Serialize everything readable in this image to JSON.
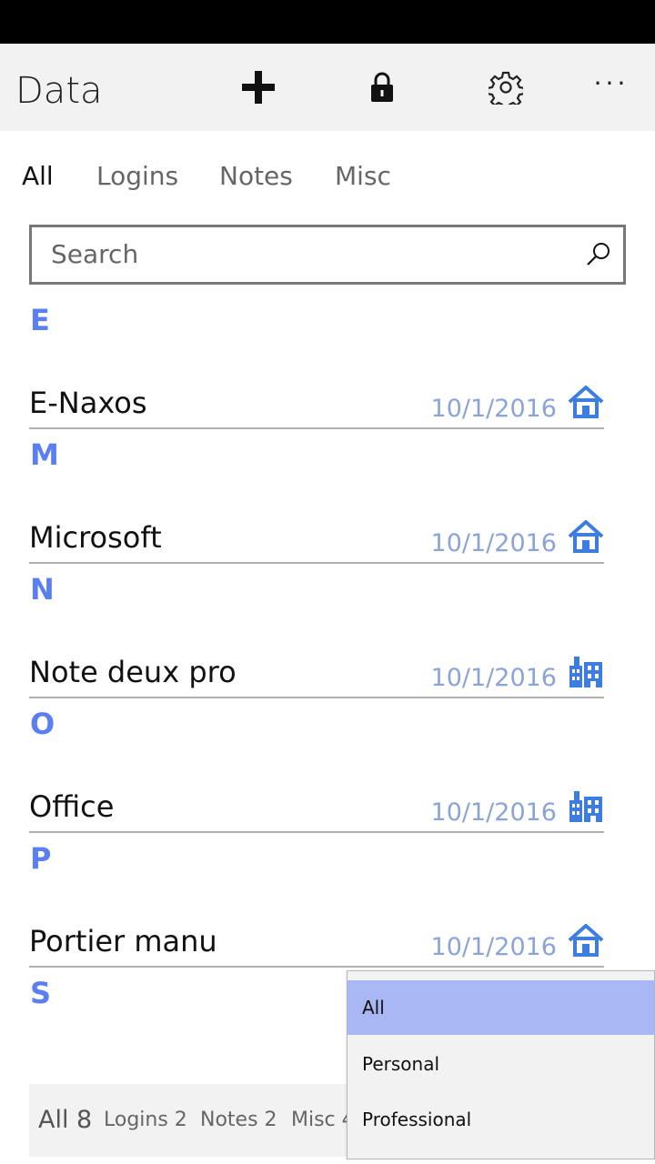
{
  "app_bar": {
    "title": "Data",
    "add_icon": "plus-icon",
    "lock_icon": "lock-icon",
    "settings_icon": "gear-icon",
    "more_label": "···"
  },
  "tabs": [
    {
      "label": "All",
      "active": true
    },
    {
      "label": "Logins",
      "active": false
    },
    {
      "label": "Notes",
      "active": false
    },
    {
      "label": "Misc",
      "active": false
    }
  ],
  "search": {
    "placeholder": "Search"
  },
  "groups": [
    {
      "letter": "E",
      "items": [
        {
          "name": "E-Naxos",
          "date": "10/1/2016",
          "icon": "home-icon"
        }
      ]
    },
    {
      "letter": "M",
      "items": [
        {
          "name": "Microsoft",
          "date": "10/1/2016",
          "icon": "home-icon"
        }
      ]
    },
    {
      "letter": "N",
      "items": [
        {
          "name": "Note deux pro",
          "date": "10/1/2016",
          "icon": "office-building-icon"
        }
      ]
    },
    {
      "letter": "O",
      "items": [
        {
          "name": "Office",
          "date": "10/1/2016",
          "icon": "office-building-icon"
        }
      ]
    },
    {
      "letter": "P",
      "items": [
        {
          "name": "Portier manu",
          "date": "10/1/2016",
          "icon": "home-icon"
        }
      ]
    },
    {
      "letter": "S",
      "items": []
    }
  ],
  "bottom_counts": {
    "all": "All 8",
    "logins": "Logins 2",
    "notes": "Notes 2",
    "misc": "Misc 4"
  },
  "filter_dropdown": {
    "options": [
      "All",
      "Personal",
      "Professional"
    ],
    "selected": "All"
  },
  "colors": {
    "accent": "#5b7ef0",
    "date": "#8aa4d8",
    "icon": "#3d7de0",
    "selected_option": "#a9b8f4"
  }
}
